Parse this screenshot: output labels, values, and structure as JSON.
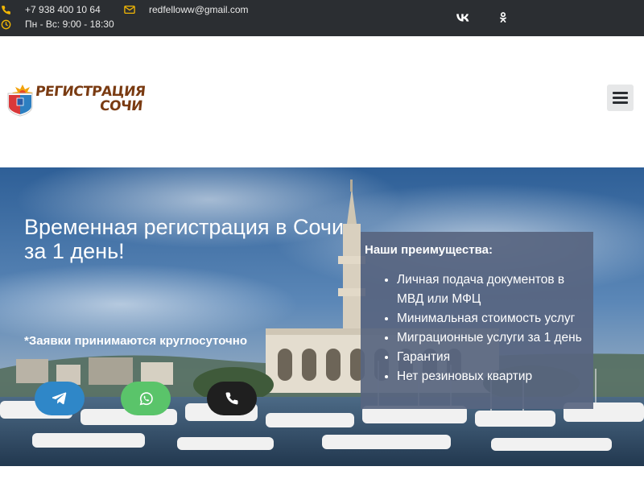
{
  "topbar": {
    "phone": "+7 938 400 10 64",
    "hours": "Пн - Вс: 9:00 - 18:30",
    "email": "redfelloww@gmail.com",
    "social": [
      {
        "name": "vk-icon",
        "label": "vk"
      },
      {
        "name": "ok-icon",
        "label": "ok"
      }
    ]
  },
  "header": {
    "logo_line1": "РЕГИСТРАЦИЯ",
    "logo_line2": "СОЧИ"
  },
  "hero": {
    "title": "Временная регистрация в Сочи за 1 день!",
    "note": "*Заявки принимаются круглосуточно",
    "buttons": [
      {
        "name": "telegram",
        "color": "#2f87c8"
      },
      {
        "name": "whatsapp",
        "color": "#5ac46a"
      },
      {
        "name": "phone",
        "color": "#1f1f1f"
      }
    ]
  },
  "advantages": {
    "title": "Наши преимущества:",
    "items": [
      "Личная подача документов в МВД или МФЦ",
      "Минимальная стоимость услуг",
      "Миграционные услуги за 1 день",
      "Гарантия",
      "Нет резиновых квартир"
    ]
  },
  "colors": {
    "topbar_bg": "#2b2e32",
    "icon_accent": "#f2b705",
    "panel_bg": "#586580"
  }
}
